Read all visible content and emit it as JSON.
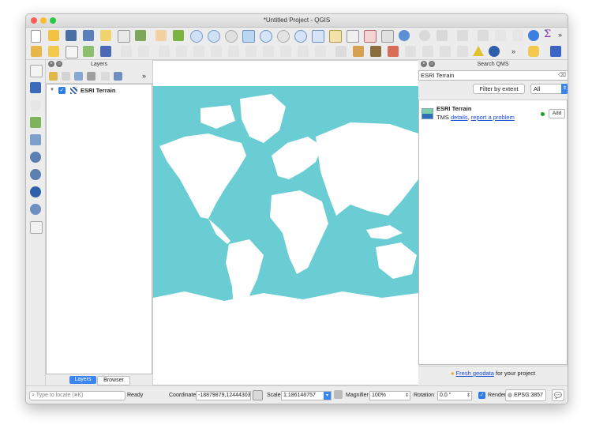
{
  "window": {
    "title": "*Untitled Project - QGIS"
  },
  "layers_panel": {
    "title": "Layers",
    "items": [
      {
        "name": "ESRI Terrain",
        "checked": true
      }
    ],
    "tabs": [
      "Layers",
      "Browser"
    ],
    "active_tab": "Layers"
  },
  "qms_panel": {
    "title": "Search QMS",
    "search_value": "ESRI Terrain",
    "filter_button": "Filter by extent",
    "filter_select": "All",
    "result": {
      "name": "ESRI Terrain",
      "type": "TMS",
      "details_link": "details",
      "report_link": "report a problem",
      "add_button": "Add",
      "status_color": "#1a9e2a"
    },
    "footer_link": "Fresh geodata",
    "footer_text": " for your project"
  },
  "status": {
    "locate_placeholder": "Type to locate (⌘K)",
    "state": "Ready",
    "coordinate_label": "Coordinate",
    "coordinate_value": "-18879879,12444303",
    "scale_label": "Scale",
    "scale_value": "1:186148757",
    "magnifier_label": "Magnifier",
    "magnifier_value": "100%",
    "rotation_label": "Rotation",
    "rotation_value": "0.0 °",
    "render_label": "Render",
    "render_checked": true,
    "crs": "EPSG:3857"
  },
  "colors": {
    "ocean": "#72d1d6",
    "ocean_deep": "#5cc6cd",
    "land": "#ffffff",
    "accent": "#2b7de9"
  }
}
